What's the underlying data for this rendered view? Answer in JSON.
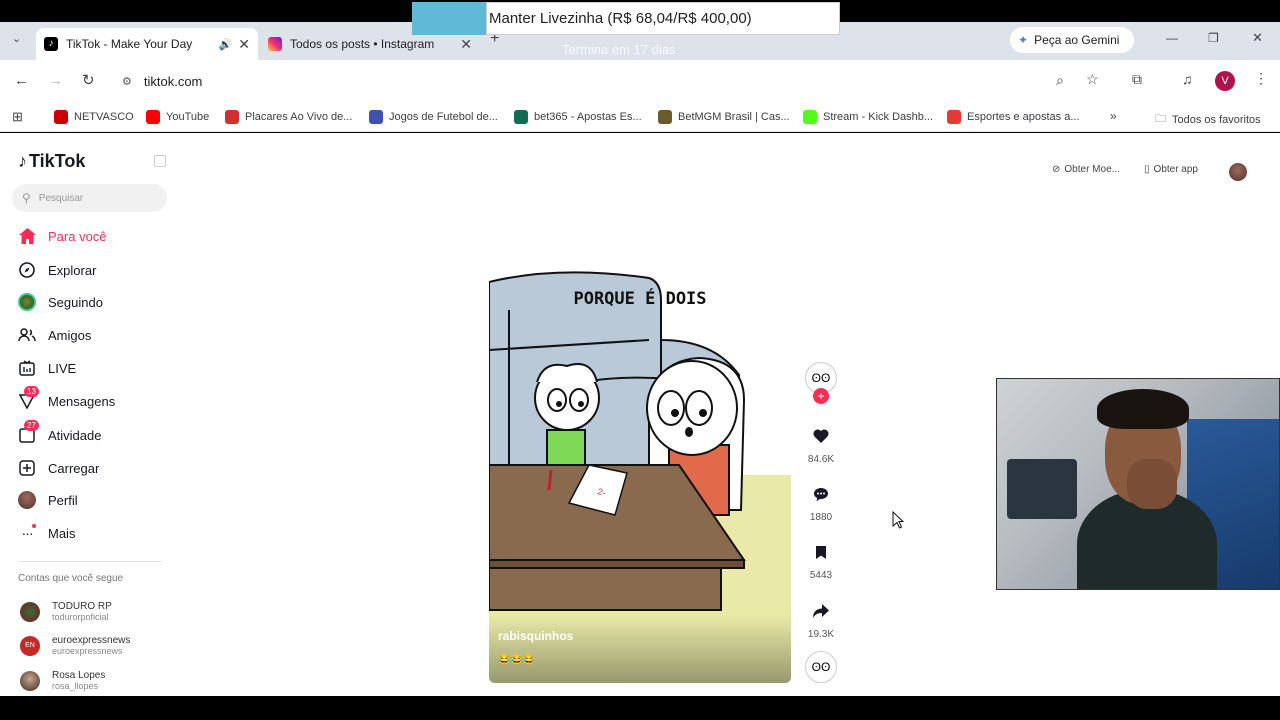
{
  "stream_overlay": {
    "goal_text": "Manter Livezinha (R$ 68,04/R$ 400,00)",
    "ends_text": "Termina em 17 dias"
  },
  "tabs": [
    {
      "title": "TikTok - Make Your Day",
      "active": true
    },
    {
      "title": "Todos os posts • Instagram",
      "active": false
    }
  ],
  "gemini_label": "Peça ao Gemini",
  "url": "tiktok.com",
  "profile_letter": "V",
  "bookmarks": [
    {
      "label": "NETVASCO",
      "color": "#c00"
    },
    {
      "label": "YouTube",
      "color": "#f00"
    },
    {
      "label": "Placares Ao Vivo de...",
      "color": "#d32f2f"
    },
    {
      "label": "Jogos de Futebol de...",
      "color": "#3f51b5"
    },
    {
      "label": "bet365 - Apostas Es...",
      "color": "#126e51"
    },
    {
      "label": "BetMGM Brasil | Cas...",
      "color": "#6b5b2a"
    },
    {
      "label": "Stream - Kick Dashb...",
      "color": "#53fc18"
    },
    {
      "label": "Esportes e apostas a...",
      "color": "#e53935"
    }
  ],
  "all_bookmarks": "Todos os favoritos",
  "tiktok": {
    "logo": "TikTok",
    "search_placeholder": "Pesquisar",
    "nav": [
      {
        "label": "Para você",
        "icon": "home-icon",
        "active": true
      },
      {
        "label": "Explorar",
        "icon": "compass-icon"
      },
      {
        "label": "Seguindo",
        "icon": "following-avatar-icon"
      },
      {
        "label": "Amigos",
        "icon": "friends-icon"
      },
      {
        "label": "LIVE",
        "icon": "live-icon"
      },
      {
        "label": "Mensagens",
        "icon": "messages-icon",
        "badge": "13"
      },
      {
        "label": "Atividade",
        "icon": "activity-icon",
        "badge": "27"
      },
      {
        "label": "Carregar",
        "icon": "upload-icon"
      },
      {
        "label": "Perfil",
        "icon": "profile-icon"
      },
      {
        "label": "Mais",
        "icon": "more-icon"
      }
    ],
    "following_header": "Contas que você segue",
    "accounts": [
      {
        "name": "TODURO RP",
        "handle": "todurorpoficial"
      },
      {
        "name": "euroexpressnews",
        "handle": "euroexpressnews"
      },
      {
        "name": "Rosa Lopes",
        "handle": "rosa_llopes"
      }
    ],
    "get_coins": "Obter Moe...",
    "get_app": "Obter app",
    "video": {
      "caption_text": "PORQUE É DOIS",
      "author": "rabisquinhos",
      "emojis": "😂😂😂",
      "paper_text": "2-"
    },
    "actions": {
      "likes": "84.6K",
      "comments": "1880",
      "saves": "5443",
      "shares": "19.3K"
    }
  }
}
